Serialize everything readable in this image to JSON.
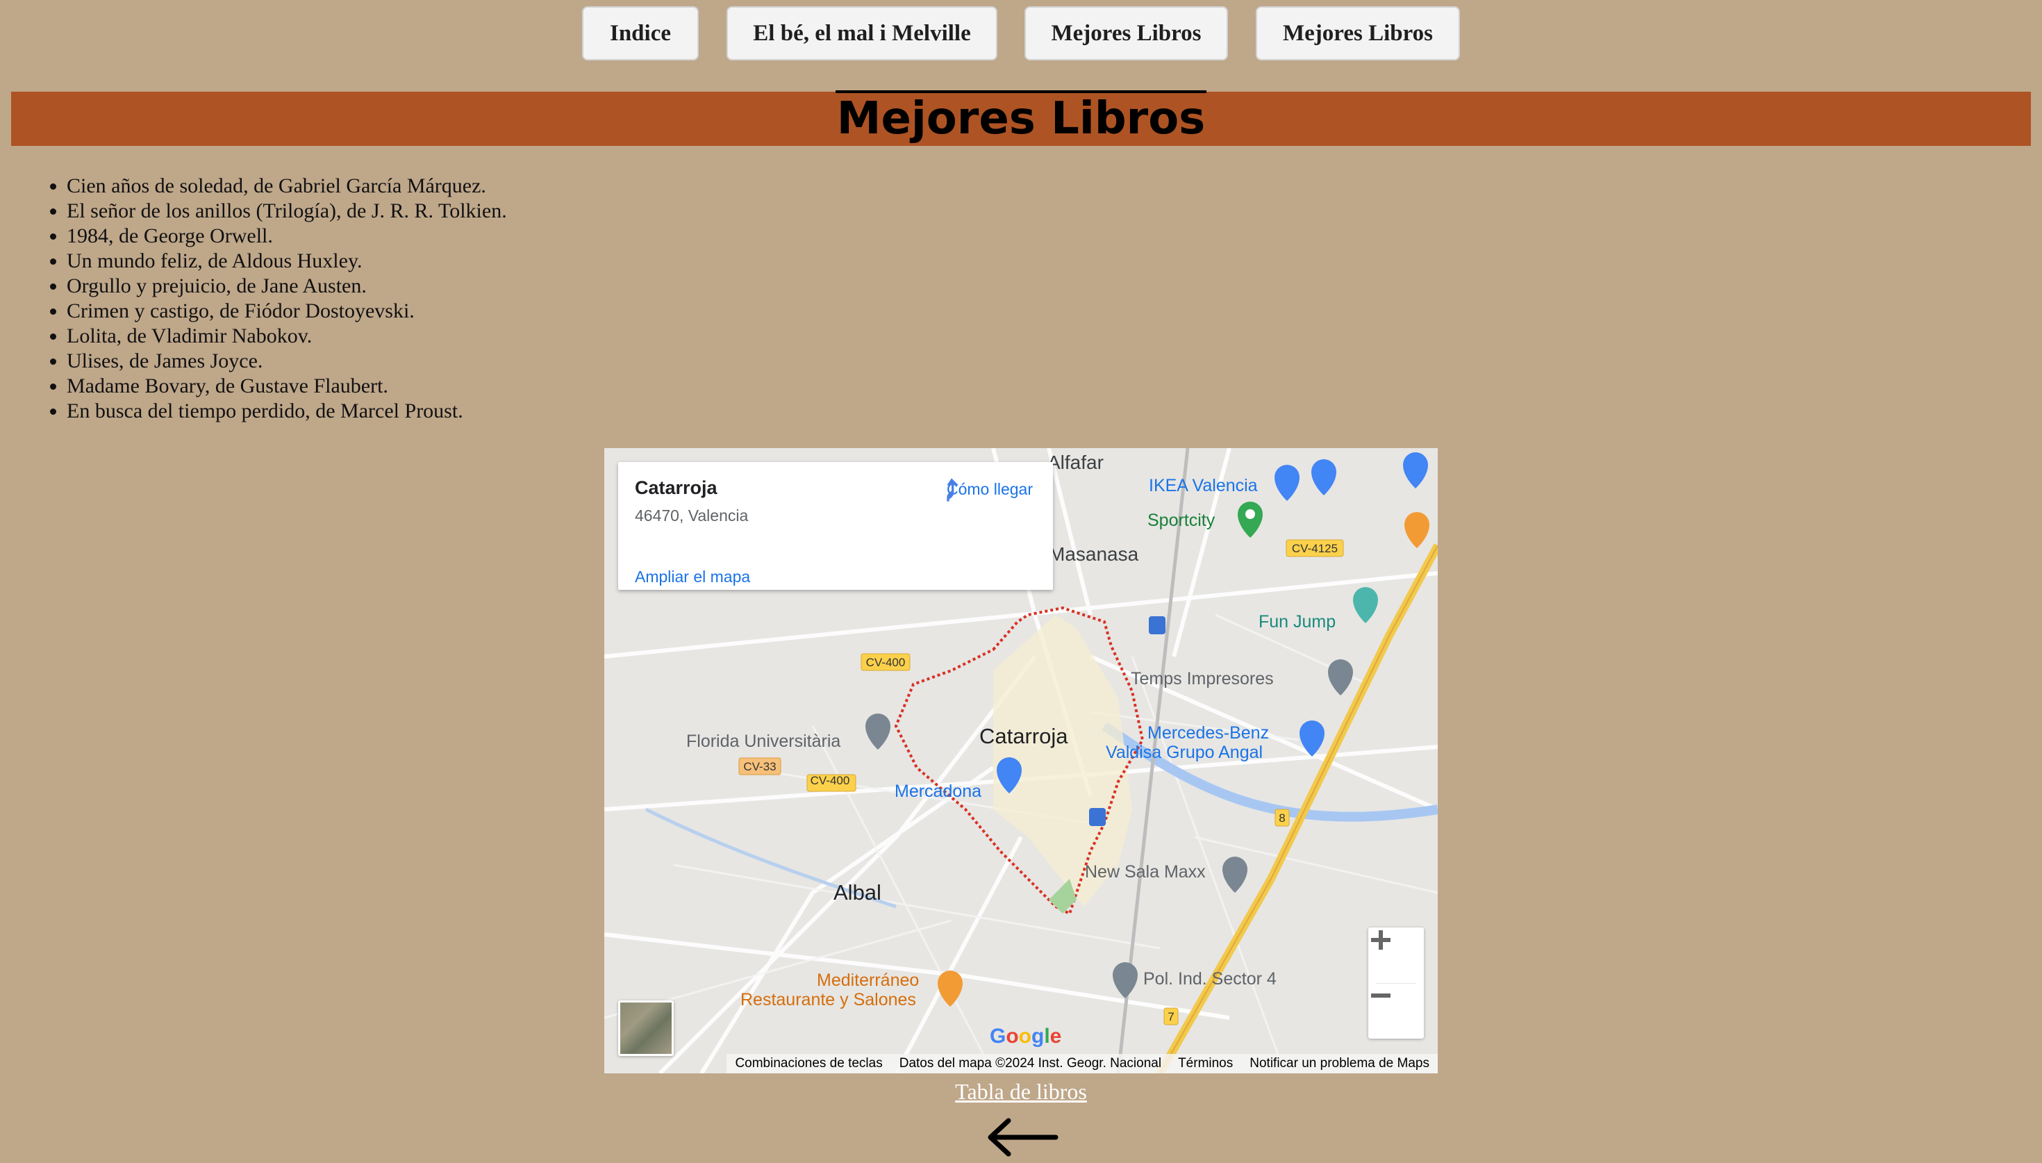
{
  "nav": {
    "buttons": [
      "Indice",
      "El bé, el mal i Melville",
      "Mejores Libros",
      "Mejores Libros"
    ]
  },
  "header": {
    "title": "Mejores Libros"
  },
  "books": [
    "Cien años de soledad, de Gabriel García Márquez.",
    "El señor de los anillos (Trilogía), de J. R. R. Tolkien.",
    "1984, de George Orwell.",
    "Un mundo feliz, de Aldous Huxley.",
    "Orgullo y prejuicio, de Jane Austen.",
    "Crimen y castigo, de Fiódor Dostoyevski.",
    "Lolita, de Vladimir Nabokov.",
    "Ulises, de James Joyce.",
    "Madame Bovary, de Gustave Flaubert.",
    "En busca del tiempo perdido, de Marcel Proust."
  ],
  "map": {
    "card": {
      "place": "Catarroja",
      "address": "46470, Valencia",
      "directions": "Cómo llegar",
      "enlarge": "Ampliar el mapa"
    },
    "labels": {
      "alfafar": "Alfafar",
      "massanassa": "Masanasa",
      "ikea": "IKEA Valencia",
      "sportcity": "Sportcity",
      "funjump": "Fun Jump",
      "temps": "Temps Impresores",
      "mercedes1": "Mercedes-Benz",
      "mercedes2": "Valdisa Grupo Angal",
      "catarroja": "Catarroja",
      "florida": "Florida Universitària",
      "mercadona": "Mercadona",
      "albal": "Albal",
      "newsala": "New Sala Maxx",
      "mediterraneo1": "Mediterráneo",
      "mediterraneo2": "Restaurante y Salones",
      "polind": "Pol. Ind. Sector 4",
      "cv400a": "CV-400",
      "cv400b": "CV-400",
      "cv33": "CV-33",
      "cv4125": "CV-4125",
      "r8": "8",
      "r7": "7",
      "google": "Google"
    },
    "attribution": [
      "Combinaciones de teclas",
      "Datos del mapa ©2024 Inst. Geogr. Nacional",
      "Términos",
      "Notificar un problema de Maps"
    ]
  },
  "footer": {
    "link": "Tabla de libros"
  },
  "colors": {
    "page_bg": "#bfa78a",
    "banner": "#ae5324",
    "link_blue": "#1a73e8",
    "highway": "#f2c94c"
  },
  "icons": [
    "directions-icon",
    "zoom-in-icon",
    "zoom-out-icon",
    "back-arrow-icon",
    "location-pin-icon",
    "shopping-pin-icon",
    "restaurant-pin-icon"
  ]
}
